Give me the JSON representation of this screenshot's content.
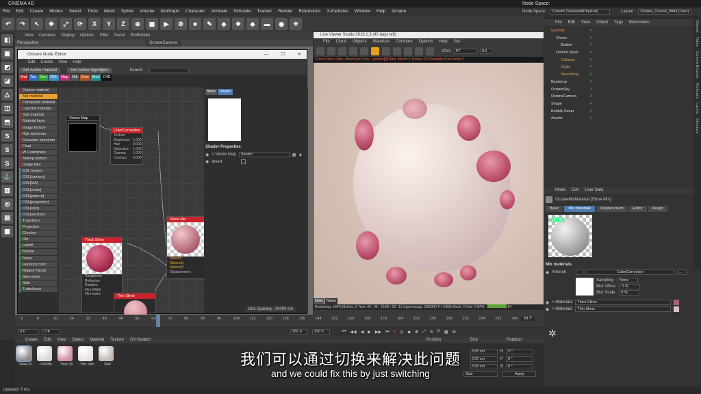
{
  "app": {
    "title": "CINEMA 4D",
    "node_space_label": "Node Space:",
    "node_space_value": "Current (Standard/Physical)",
    "layout_label": "Layout:",
    "layout_value": "Octane_Course_Wide (User)"
  },
  "menubar": [
    "File",
    "Edit",
    "Create",
    "Modes",
    "Select",
    "Tools",
    "Mesh",
    "Spline",
    "Volume",
    "MoGraph",
    "Character",
    "Animate",
    "Simulate",
    "Tracker",
    "Render",
    "Extensions",
    "X-Particles",
    "Window",
    "Help",
    "Octane"
  ],
  "toolbar_icons": [
    {
      "name": "undo-icon",
      "glyph": "↶"
    },
    {
      "name": "redo-icon",
      "glyph": "↷"
    },
    {
      "name": "select-icon",
      "glyph": "↖"
    },
    {
      "name": "move-icon",
      "glyph": "✥"
    },
    {
      "name": "scale-icon",
      "glyph": "⤢"
    },
    {
      "name": "rotate-icon",
      "glyph": "⟳"
    },
    {
      "name": "axis-x-icon",
      "glyph": "X"
    },
    {
      "name": "axis-y-icon",
      "glyph": "Y"
    },
    {
      "name": "axis-z-icon",
      "glyph": "Z"
    },
    {
      "name": "world-icon",
      "glyph": "⊕"
    },
    {
      "name": "render-region-icon",
      "glyph": "▦"
    },
    {
      "name": "render-view-icon",
      "glyph": "▶"
    },
    {
      "name": "render-settings-icon",
      "glyph": "⚙"
    },
    {
      "name": "cube-icon",
      "glyph": "■"
    },
    {
      "name": "pen-icon",
      "glyph": "✎"
    },
    {
      "name": "subdivision-icon",
      "glyph": "◈"
    },
    {
      "name": "cloner-icon",
      "glyph": "❖"
    },
    {
      "name": "deformer-icon",
      "glyph": "◆"
    },
    {
      "name": "floor-icon",
      "glyph": "▬"
    },
    {
      "name": "camera-icon",
      "glyph": "◉"
    },
    {
      "name": "light-icon",
      "glyph": "☀"
    }
  ],
  "left_tools": [
    "◧",
    "▣",
    "◩",
    "◪",
    "△",
    "◫",
    "⬒",
    "S",
    "S",
    "S",
    "⚓",
    "▥",
    "◎",
    "▧",
    "▩"
  ],
  "viewport": {
    "menu": [
      "View",
      "Cameras",
      "Display",
      "Options",
      "Filter",
      "Panel",
      "ProRender"
    ],
    "name": "Perspective",
    "camera": "OctaneCamera"
  },
  "node_editor": {
    "title": "Octane Node Editor",
    "menu": [
      "Edit",
      "Create",
      "View",
      "Help"
    ],
    "get_active_material": "Get Active material",
    "get_active_tag": "Get Active tag/object",
    "search_label": "Search",
    "tabs": [
      {
        "label": "Mat",
        "color": "#c8222a"
      },
      {
        "label": "Tex",
        "color": "#3a6fd0"
      },
      {
        "label": "Gen",
        "color": "#2ea03a"
      },
      {
        "label": "OSL",
        "color": "#3b8fc0"
      },
      {
        "label": "Map",
        "color": "#b83070"
      },
      {
        "label": "Oth",
        "color": "#555555"
      },
      {
        "label": "Ems",
        "color": "#b05020"
      },
      {
        "label": "Med",
        "color": "#2090a0"
      },
      {
        "label": "C4D",
        "color": "#111111"
      }
    ],
    "node_list": [
      {
        "label": "Octane material",
        "color": "#c8222a"
      },
      {
        "label": "Mix material",
        "color": "#e8a030"
      },
      {
        "label": "Composite material",
        "color": "#c8222a"
      },
      {
        "label": "Layered material",
        "color": "#c8222a"
      },
      {
        "label": "Sub material",
        "color": "#c8222a"
      },
      {
        "label": "Material layer",
        "color": "#c8222a"
      },
      {
        "label": "Image texture",
        "color": "#c8222a"
      },
      {
        "label": "Rgb spectrum",
        "color": "#c8222a"
      },
      {
        "label": "Gaussian spectrum",
        "color": "#c8222a"
      },
      {
        "label": "Float",
        "color": "#c8222a"
      },
      {
        "label": "W Coordinate",
        "color": "#c8222a"
      },
      {
        "label": "Baking texture",
        "color": "#c8222a"
      },
      {
        "label": "Image tiles",
        "color": "#c8222a"
      },
      {
        "label": "OSL texture",
        "color": "#3b8fc0"
      },
      {
        "label": "OSL[camera]",
        "color": "#3b8fc0"
      },
      {
        "label": "OSL[MA]",
        "color": "#3b8fc0"
      },
      {
        "label": "OSL[noise]",
        "color": "#3b8fc0"
      },
      {
        "label": "OSL[pattern]",
        "color": "#3b8fc0"
      },
      {
        "label": "OSL[projection]",
        "color": "#3b8fc0"
      },
      {
        "label": "OSL[utils]",
        "color": "#3b8fc0"
      },
      {
        "label": "OSL[vectron]",
        "color": "#3b8fc0"
      },
      {
        "label": "Transform",
        "color": "#2ea03a"
      },
      {
        "label": "Projection",
        "color": "#2ea03a"
      },
      {
        "label": "Checker",
        "color": "#2ea03a"
      },
      {
        "label": "Dirt",
        "color": "#2ea03a"
      },
      {
        "label": "Falloff",
        "color": "#2ea03a"
      },
      {
        "label": "Marble",
        "color": "#2ea03a"
      },
      {
        "label": "Noise",
        "color": "#2ea03a"
      },
      {
        "label": "Random color",
        "color": "#2ea03a"
      },
      {
        "label": "Ridged fractal",
        "color": "#2ea03a"
      },
      {
        "label": "Sine wave",
        "color": "#2ea03a"
      },
      {
        "label": "Side",
        "color": "#2ea03a"
      },
      {
        "label": "Turbulence",
        "color": "#2ea03a"
      }
    ],
    "vertex_map": {
      "title": "Vertex Map"
    },
    "color_correction": {
      "title": "ColorCorrection",
      "params": [
        {
          "k": "Texture",
          "v": ""
        },
        {
          "k": "Brightness",
          "v": "1.000"
        },
        {
          "k": "Hue",
          "v": "0.000"
        },
        {
          "k": "Saturation",
          "v": "1.000"
        },
        {
          "k": "Gamma",
          "v": "1.000"
        },
        {
          "k": "Contrast",
          "v": "0.000"
        }
      ]
    },
    "slime_mix": {
      "title": "Slime Mix",
      "params": [
        "Amount",
        "Material1",
        "Material2",
        "Displacement"
      ]
    },
    "thick_slime": {
      "title": "Thick Slime",
      "params": [
        "Roughness",
        "Reflection",
        "Rotation",
        "Film Width",
        "Film Index"
      ]
    },
    "thin_slime": {
      "title": "Thin Slime"
    },
    "attr": {
      "tabs": [
        "Basic",
        "Shader"
      ],
      "shader_properties": "Shader Properties",
      "vertex_map_label": "> Vertex Map",
      "vertex_map_value": "Stretch",
      "invert_label": "Invert"
    },
    "grid_spacing": "Grid Spacing : 10000 cm"
  },
  "live_viewer": {
    "title": "Live Viewer Studio 2019.1.3 (40 days left)",
    "menu": [
      "File",
      "Cloud",
      "Objects",
      "Materials",
      "Compare",
      "Options",
      "Help",
      "Gui"
    ],
    "chn_label": "Chn:",
    "chn_value": "PT",
    "chn_num": "0.6",
    "status": "Check:0ms./1ms. MeshGen:2ms. Update[0]:0ms. Mesh:1 Nodes:23 Movable:4 txCache:1",
    "tabs": [
      "Main",
      "Noise"
    ],
    "rendering": "Rendering: 100%  Ms/sec: 0    Time: 00 : 00 : 12/00 : 00 : 12    Spp/maxspp: 300/300    Tri: 0/52k    Mesh: 2 Hair: 0    GPU:",
    "gpu": "64"
  },
  "object_manager": {
    "menu": [
      "File",
      "Edit",
      "View",
      "Object",
      "Tags",
      "Bookmarks"
    ],
    "objects": [
      {
        "label": "GeoBall",
        "indent": 0,
        "color": "#e09060"
      },
      {
        "label": "Cloner",
        "indent": 1,
        "color": "#ddd"
      },
      {
        "label": "Bubble",
        "indent": 2,
        "color": "#ddd"
      },
      {
        "label": "Deform Mesh",
        "indent": 1,
        "color": "#ddd"
      },
      {
        "label": "Collision",
        "indent": 2,
        "color": "#e0a050"
      },
      {
        "label": "Jiggle",
        "indent": 2,
        "color": "#e0a050"
      },
      {
        "label": "Smoothing",
        "indent": 2,
        "color": "#e0a050"
      },
      {
        "label": "Backdrop",
        "indent": 0,
        "color": "#ddd"
      },
      {
        "label": "OctaneSky",
        "indent": 0,
        "color": "#ddd"
      },
      {
        "label": "OctaneCamera",
        "indent": 0,
        "color": "#ddd"
      },
      {
        "label": "Shape",
        "indent": 0,
        "color": "#ddd"
      },
      {
        "label": "Bubble Setup",
        "indent": 0,
        "color": "#ddd"
      },
      {
        "label": "Assets",
        "indent": 0,
        "color": "#ddd"
      }
    ]
  },
  "attributes": {
    "menu": [
      "Mode",
      "Edit",
      "User Data"
    ],
    "material_name": "OctaneMixMaterial [Slime Mix]",
    "tabs": [
      "Basic",
      "Mix materials",
      "Displacement",
      "Editor",
      "Assign"
    ],
    "mix_badge": "MIX",
    "section": "Mix materials",
    "amount_label": "Amount",
    "amount_value": "ColorCorrection",
    "sampling_label": "Sampling",
    "sampling_value": "None",
    "blur_offset_label": "Blur Offset",
    "blur_offset_value": "0 %",
    "blur_scale_label": "Blur Scale",
    "blur_scale_value": "0 %",
    "material1_label": "> Material1",
    "material1_value": "Thick Slime",
    "material2_label": "> Material2",
    "material2_value": "Thin Slime"
  },
  "side_tabs": [
    "Objects",
    "Takes",
    "Content Browser",
    "Attributes",
    "Layers",
    "Structure"
  ],
  "timeline": {
    "ticks": [
      "0",
      "8",
      "16",
      "24",
      "32",
      "40",
      "48",
      "56",
      "64",
      "72",
      "80",
      "88",
      "96",
      "104",
      "112",
      "120",
      "128",
      "136",
      "144",
      "152",
      "160",
      "168",
      "176",
      "184",
      "192",
      "200",
      "208",
      "216",
      "224",
      "232",
      "240",
      "248"
    ],
    "end": "64 F",
    "current_frame": "0 F",
    "start": "0 F",
    "total": "250 F",
    "total2": "250 F",
    "playhead": 0.256
  },
  "material_manager": {
    "menu": [
      "Create",
      "Edit",
      "View",
      "Select",
      "Material",
      "Texture",
      "CV-Swatch"
    ],
    "materials": [
      {
        "label": "Slime M",
        "color": "#8a8a8a"
      },
      {
        "label": "OctDiffu",
        "color": "#d8d8d8"
      },
      {
        "label": "Thick Sli",
        "color": "#d090a0"
      },
      {
        "label": "Thin Slim",
        "color": "#e8e0e0"
      },
      {
        "label": "Wall",
        "color": "#c0b8b0"
      }
    ]
  },
  "coords": {
    "position": "Position",
    "size": "Size",
    "rotation": "Rotation",
    "s1": "578 cm",
    "s2": "578 cm",
    "s3": "578 cm",
    "h": "H",
    "p": "P",
    "b": "B",
    "r1": "0 °",
    "r2": "0 °",
    "r3": "0 °",
    "size_sel": "Size",
    "apply": "Apply"
  },
  "status_bar": "Updated: 0 ms.",
  "subtitles": {
    "cn": "我们可以通过切换来解决此问题",
    "en": "and we could fix this by just switching"
  }
}
